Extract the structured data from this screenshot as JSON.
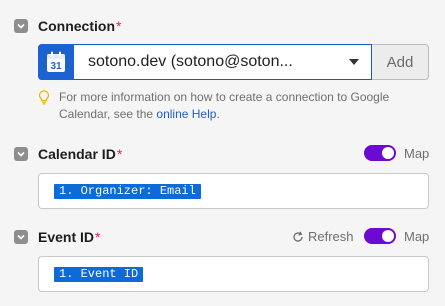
{
  "connection": {
    "label": "Connection",
    "required_mark": "*",
    "selected_value": "sotono.dev (sotono@soton...",
    "calendar_icon_text": "31",
    "add_label": "Add",
    "hint_prefix": "For more information on how to create a connection to Google Calendar, see the ",
    "hint_link": "online Help",
    "hint_suffix": "."
  },
  "calendar_id": {
    "label": "Calendar ID",
    "required_mark": "*",
    "map_label": "Map",
    "map_enabled": true,
    "value_pill": "1. Organizer: Email"
  },
  "event_id": {
    "label": "Event ID",
    "required_mark": "*",
    "refresh_label": "Refresh",
    "map_label": "Map",
    "map_enabled": true,
    "value_pill": "1. Event ID"
  },
  "colors": {
    "toggle_on": "#6c0ad4",
    "pill_bg": "#0d6ad9",
    "link": "#1d5fd0",
    "required": "#e2264d",
    "google_blue": "#1d62d1"
  }
}
